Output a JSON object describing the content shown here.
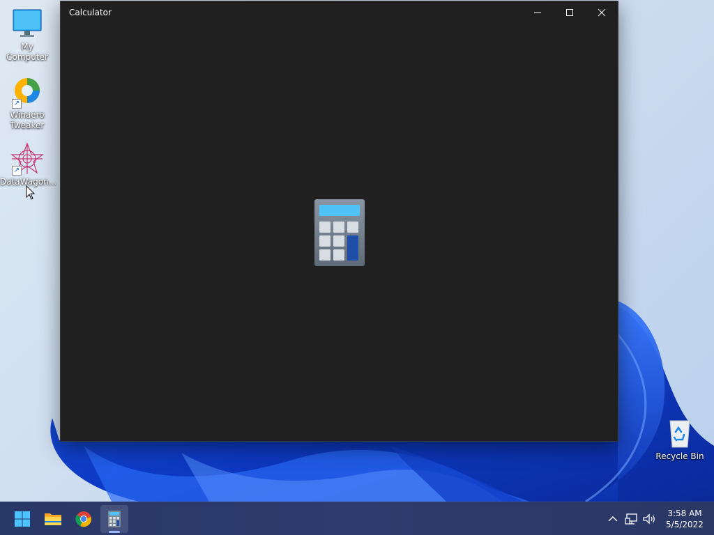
{
  "desktop": {
    "icons": [
      {
        "label": "My Computer"
      },
      {
        "label": "Winaero Tweaker"
      },
      {
        "label": "DataWagon..."
      },
      {
        "label": "Recycle Bin"
      }
    ]
  },
  "window": {
    "title": "Calculator",
    "controls": {
      "minimize": "minimize-icon",
      "maximize": "maximize-icon",
      "close": "close-icon"
    },
    "background": "#202020"
  },
  "taskbar": {
    "apps": [
      {
        "icon": "windows-start-icon"
      },
      {
        "icon": "file-explorer-icon"
      },
      {
        "icon": "chrome-icon"
      },
      {
        "icon": "calculator-icon",
        "active": true
      }
    ],
    "tray": {
      "icons": [
        "chevron-up-icon",
        "network-icon",
        "volume-icon"
      ],
      "time": "3:58 AM",
      "date": "5/5/2022"
    },
    "color": "#2b3a6b"
  },
  "colors": {
    "accent": "#4fc3f7",
    "calc_display": "#4fc3f7",
    "calc_key_blue": "#1e4ea8"
  }
}
